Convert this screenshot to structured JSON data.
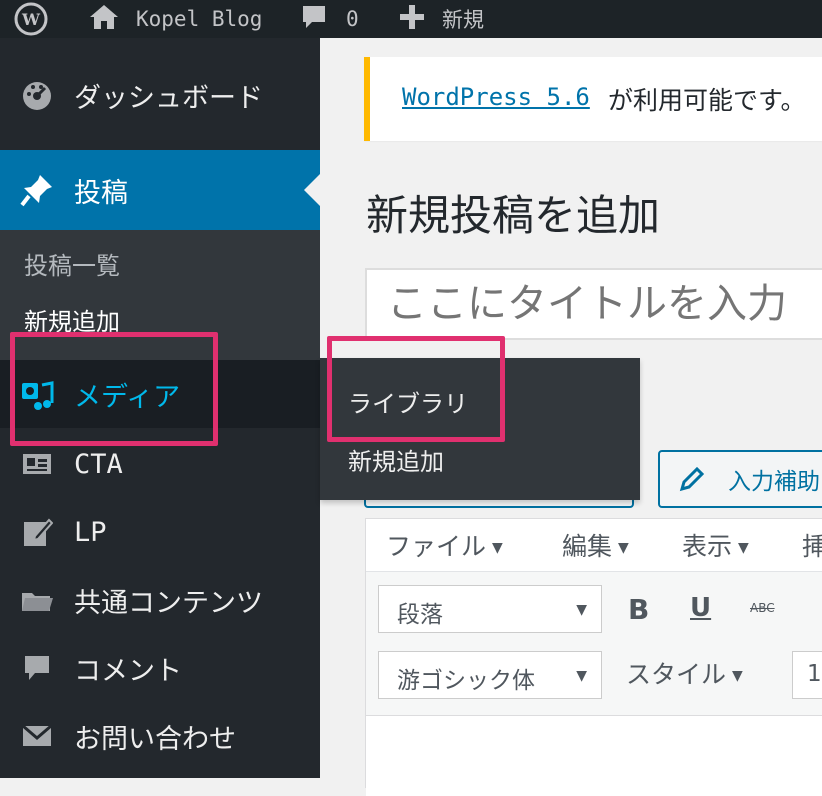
{
  "admin_bar": {
    "site_name": "Kopel Blog",
    "comment_count": "0",
    "new_label": "新規"
  },
  "notice": {
    "link_text": "WordPress 5.6",
    "rest_text": "が利用可能です。"
  },
  "page_title": "新規投稿を追加",
  "title_input": {
    "placeholder": "ここにタイトルを入力"
  },
  "sidebar": {
    "dashboard": "ダッシュボード",
    "posts": "投稿",
    "posts_submenu": [
      "投稿一覧",
      "新規追加"
    ],
    "media": "メディア",
    "cta": "CTA",
    "lp": "LP",
    "common": "共通コンテンツ",
    "comments": "コメント",
    "contact": "お問い合わせ"
  },
  "media_flyout": [
    "ライブラリ",
    "新規追加"
  ],
  "editor": {
    "assist_button": "入力補助",
    "menubar": [
      "ファイル",
      "編集",
      "表示",
      "挿"
    ],
    "format_select": "段落",
    "font_select": "游ゴシック体",
    "style_label": "スタイル",
    "size_value": "1",
    "bold": "B",
    "underline": "U",
    "strike": "ABC"
  },
  "colors": {
    "admin_bar": "#1d2327",
    "sidebar": "#23282d",
    "active": "#0073aa",
    "media_active_text": "#00b9eb",
    "highlight": "#e0306f",
    "notice_border": "#ffb900"
  }
}
